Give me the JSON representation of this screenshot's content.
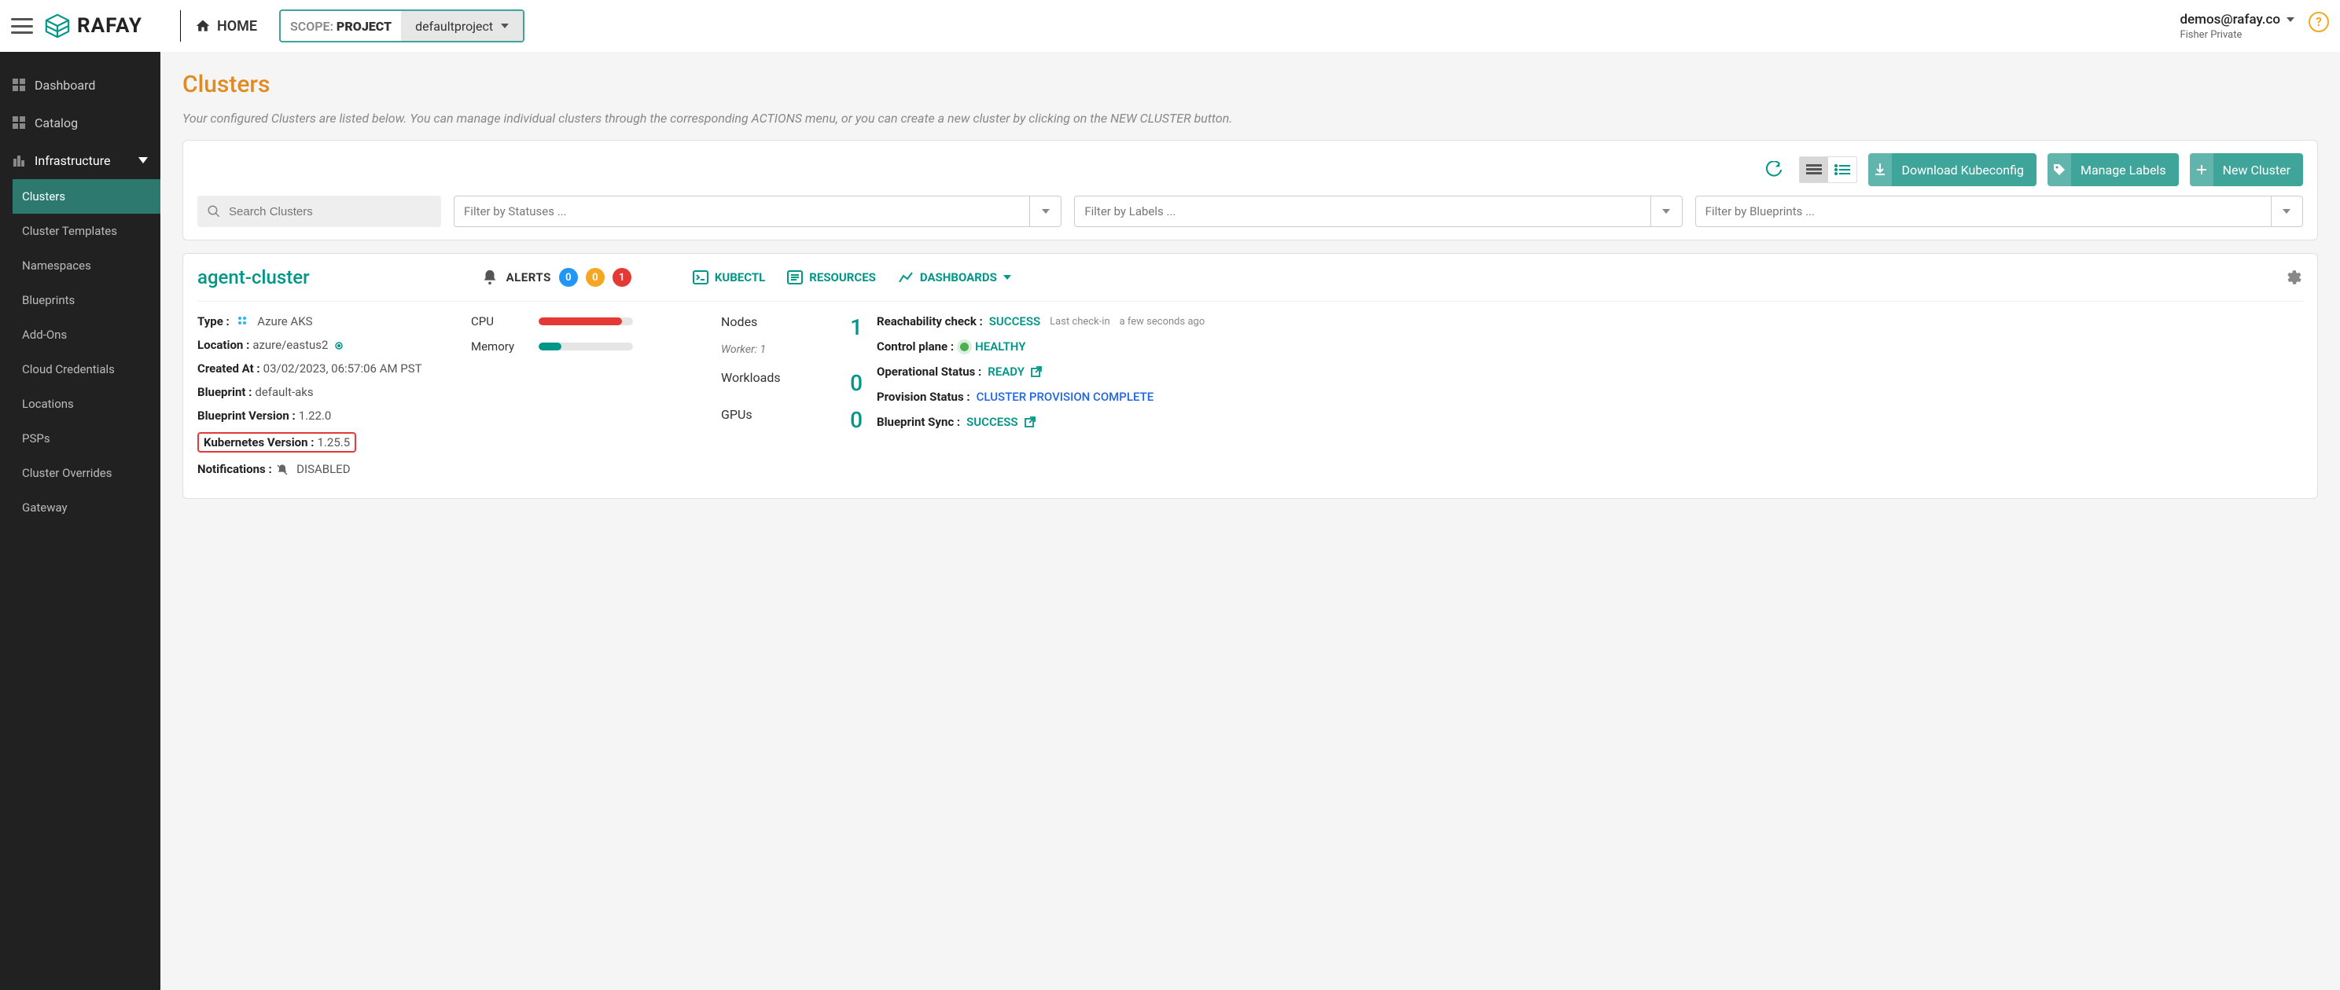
{
  "topbar": {
    "logo_text": "RAFAY",
    "home": "HOME",
    "scope_label": "SCOPE:",
    "scope_kind": "PROJECT",
    "scope_value": "defaultproject",
    "user_email": "demos@rafay.co",
    "user_sub": "Fisher Private"
  },
  "sidebar": {
    "items": [
      {
        "label": "Dashboard"
      },
      {
        "label": "Catalog"
      },
      {
        "label": "Infrastructure",
        "expanded": true,
        "children": [
          {
            "label": "Clusters",
            "active": true
          },
          {
            "label": "Cluster Templates"
          },
          {
            "label": "Namespaces"
          },
          {
            "label": "Blueprints"
          },
          {
            "label": "Add-Ons"
          },
          {
            "label": "Cloud Credentials"
          },
          {
            "label": "Locations"
          },
          {
            "label": "PSPs"
          },
          {
            "label": "Cluster Overrides"
          },
          {
            "label": "Gateway"
          }
        ]
      }
    ]
  },
  "page": {
    "title": "Clusters",
    "desc": "Your configured Clusters are listed below. You can manage individual clusters through the corresponding ACTIONS menu, or you can create a new cluster by clicking on the NEW CLUSTER button."
  },
  "toolbar": {
    "download_kubeconfig": "Download Kubeconfig",
    "manage_labels": "Manage Labels",
    "new_cluster": "New Cluster"
  },
  "filters": {
    "search_placeholder": "Search Clusters",
    "status_placeholder": "Filter by Statuses ...",
    "labels_placeholder": "Filter by Labels ...",
    "blueprints_placeholder": "Filter by Blueprints ..."
  },
  "cluster": {
    "name": "agent-cluster",
    "alerts_label": "ALERTS",
    "alerts_blue": "0",
    "alerts_orange": "0",
    "alerts_red": "1",
    "actions": {
      "kubectl": "KUBECTL",
      "resources": "RESOURCES",
      "dashboards": "DASHBOARDS"
    },
    "kv": {
      "type_k": "Type :",
      "type_v": "Azure AKS",
      "location_k": "Location :",
      "location_v": "azure/eastus2",
      "created_k": "Created At :",
      "created_v": "03/02/2023, 06:57:06 AM PST",
      "blueprint_k": "Blueprint :",
      "blueprint_v": "default-aks",
      "bpver_k": "Blueprint Version :",
      "bpver_v": "1.22.0",
      "k8sver_k": "Kubernetes Version :",
      "k8sver_v": "1.25.5",
      "notif_k": "Notifications :",
      "notif_v": "DISABLED"
    },
    "bars": {
      "cpu_label": "CPU",
      "cpu_pct": 88,
      "cpu_color": "#e53935",
      "mem_label": "Memory",
      "mem_pct": 24,
      "mem_color": "#009688"
    },
    "counts": {
      "nodes_k": "Nodes",
      "nodes_v": "1",
      "worker": "Worker: 1",
      "workloads_k": "Workloads",
      "workloads_v": "0",
      "gpus_k": "GPUs",
      "gpus_v": "0"
    },
    "status": {
      "reach_k": "Reachability check :",
      "reach_v": "SUCCESS",
      "reach_meta1": "Last check-in",
      "reach_meta2": "a few seconds ago",
      "cp_k": "Control plane :",
      "cp_v": "HEALTHY",
      "op_k": "Operational Status :",
      "op_v": "READY",
      "prov_k": "Provision Status :",
      "prov_v": "CLUSTER PROVISION COMPLETE",
      "bps_k": "Blueprint Sync :",
      "bps_v": "SUCCESS"
    }
  }
}
